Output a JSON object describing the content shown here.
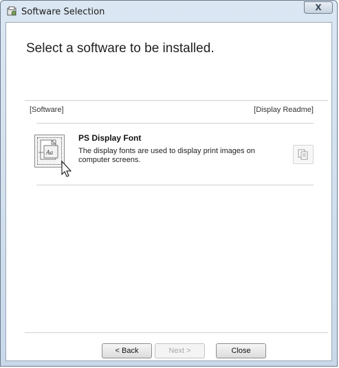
{
  "window": {
    "title": "Software Selection",
    "close_glyph": "X"
  },
  "main": {
    "heading": "Select a software to be installed.",
    "columns": {
      "software": "[Software]",
      "readme": "[Display Readme]"
    },
    "items": [
      {
        "name": "PS Display Font",
        "description": "The display fonts are used to display print images on computer screens.",
        "icon": "font-package-icon",
        "readme_icon": "readme-document-icon"
      }
    ]
  },
  "footer": {
    "back_label": "< Back",
    "next_label": "Next >",
    "close_label": "Close",
    "next_enabled": false
  }
}
